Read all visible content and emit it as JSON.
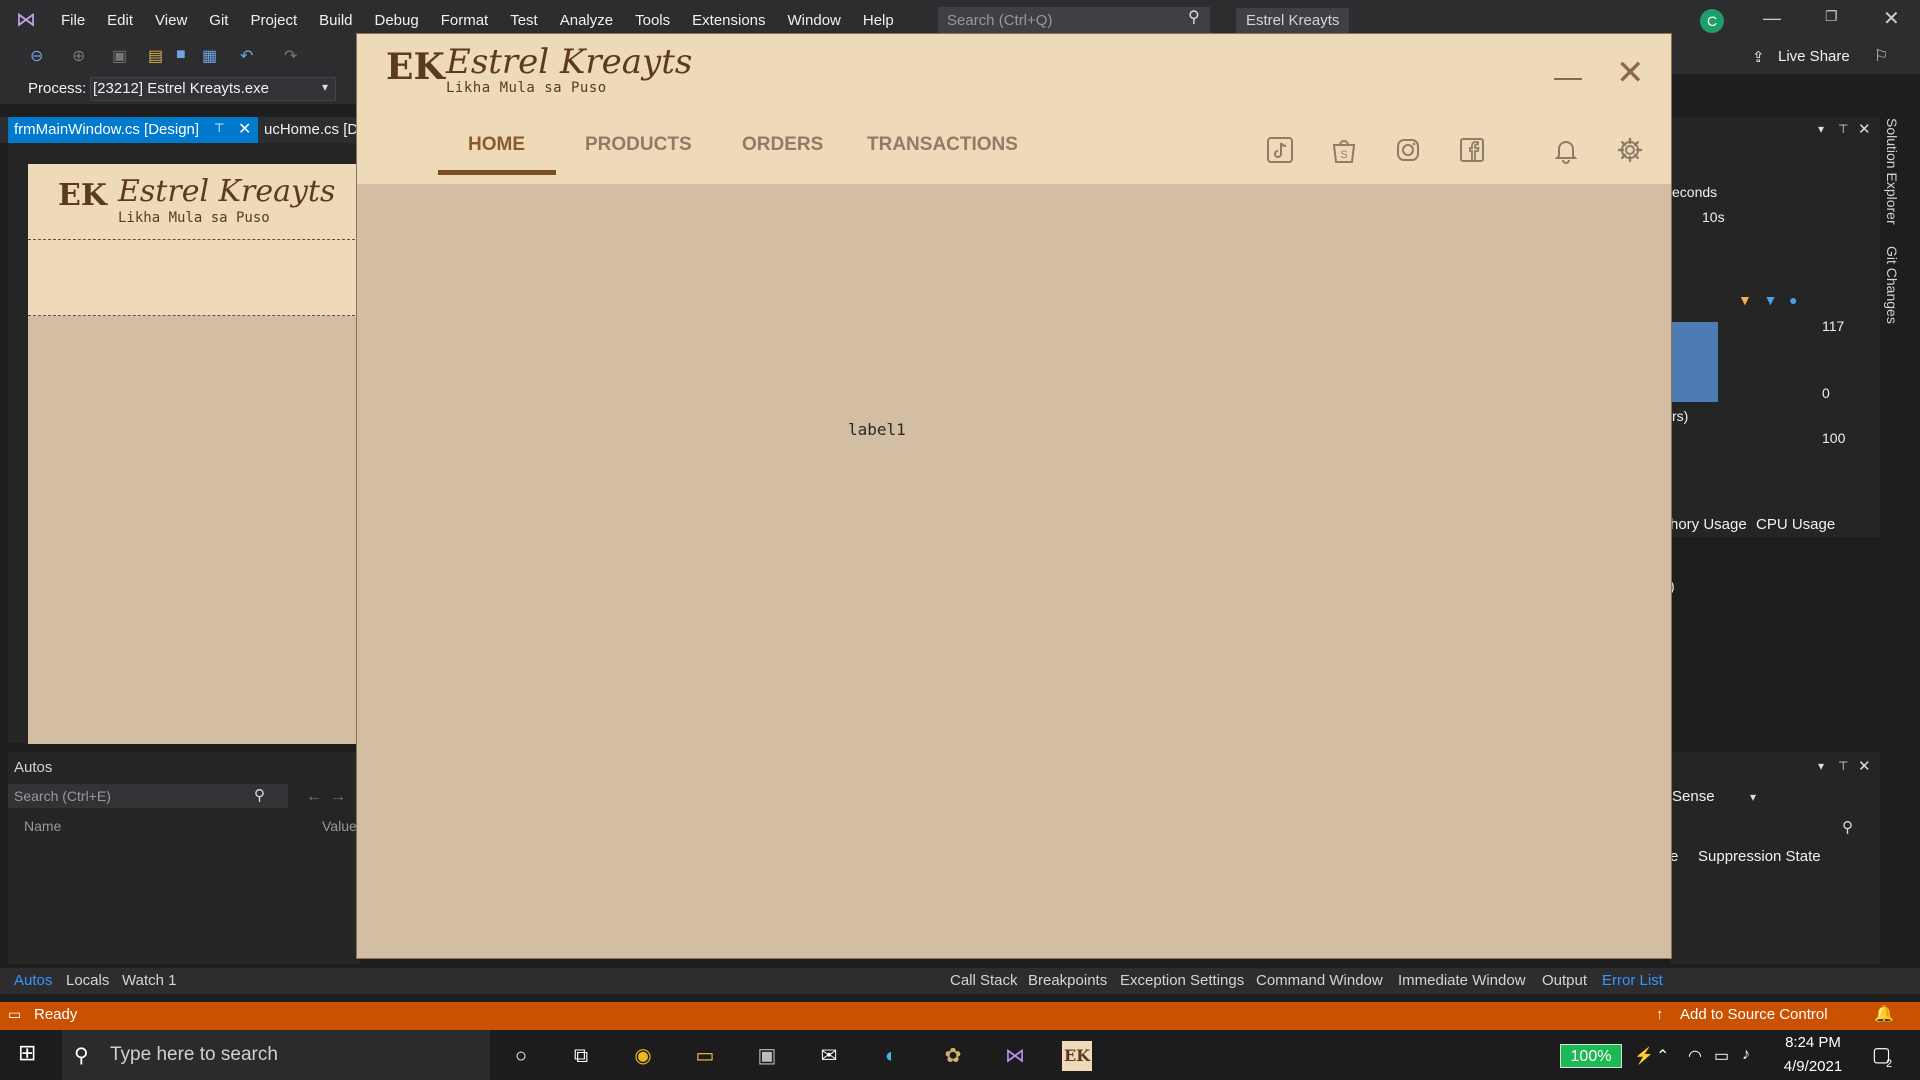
{
  "vs": {
    "menu": [
      "File",
      "Edit",
      "View",
      "Git",
      "Project",
      "Build",
      "Debug",
      "Format",
      "Test",
      "Analyze",
      "Tools",
      "Extensions",
      "Window",
      "Help"
    ],
    "search_placeholder": "Search (Ctrl+Q)",
    "solution_name": "Estrel Kreayts",
    "user_initial": "C",
    "live_share": "Live Share",
    "process_label": "Process:",
    "process_value": "[23212] Estrel Kreayts.exe",
    "tabs": {
      "active": "frmMainWindow.cs [Design]",
      "second": "ucHome.cs [D"
    },
    "designer": {
      "logo": "EK",
      "title": "Estrel Kreayts",
      "tagline": "Likha Mula sa Puso"
    },
    "autos": {
      "title": "Autos",
      "search_placeholder": "Search (Ctrl+E)",
      "col_name": "Name",
      "col_value": "Value"
    },
    "bottom_tabs_left": [
      "Autos",
      "Locals",
      "Watch 1"
    ],
    "bottom_tabs_right": [
      "Call Stack",
      "Breakpoints",
      "Exception Settings",
      "Command Window",
      "Immediate Window",
      "Output",
      "Error List"
    ],
    "status": {
      "ready": "Ready",
      "source_control": "Add to Source Control"
    },
    "diagnostics": {
      "seconds": "econds",
      "interval": "10s",
      "value_117": "117",
      "value_0": "0",
      "rs": "rs)",
      "value_100": "100",
      "memory_tab": "hory Usage",
      "cpu_tab": "CPU Usage",
      "paren": ")"
    },
    "error_list": {
      "sense": "Sense",
      "suppression": "Suppression State",
      "e": "e"
    },
    "side_tabs": {
      "solution": "Solution Explorer",
      "git": "Git Changes"
    }
  },
  "app": {
    "logo": "EK",
    "title": "Estrel Kreayts",
    "tagline": "Likha Mula sa Puso",
    "nav": [
      "HOME",
      "PRODUCTS",
      "ORDERS",
      "TRANSACTIONS"
    ],
    "label1": "label1",
    "colors": {
      "header": "#eed9b8",
      "body": "#d4bea3",
      "accent": "#7a4e25",
      "nav_muted": "#8f7c66"
    }
  },
  "taskbar": {
    "search_placeholder": "Type here to search",
    "battery": "100%",
    "time": "8:24 PM",
    "date": "4/9/2021",
    "notif_count": "2"
  }
}
